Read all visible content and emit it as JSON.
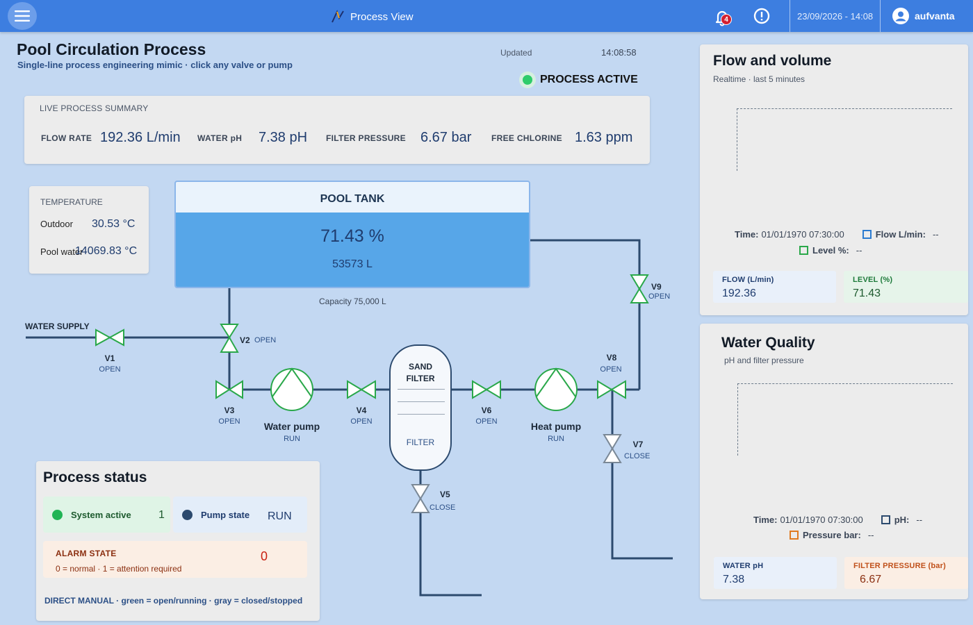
{
  "topbar": {
    "app_title": "Process View",
    "notification_count": "4",
    "datetime": "23/09/2026 - 14:08",
    "user": "aufvanta"
  },
  "header": {
    "title": "Pool Circulation Process",
    "subtitle": "Single-line process engineering mimic · click any valve or pump",
    "updated_label": "Updated",
    "updated_time": "14:08:58",
    "process_state": "PROCESS ACTIVE"
  },
  "summary": {
    "title": "LIVE PROCESS SUMMARY",
    "flow_label": "FLOW RATE",
    "flow_value": "192.36 L/min",
    "ph_label": "WATER pH",
    "ph_value": "7.38 pH",
    "pressure_label": "FILTER PRESSURE",
    "pressure_value": "6.67 bar",
    "chlorine_label": "FREE CHLORINE",
    "chlorine_value": "1.63 ppm"
  },
  "temperature": {
    "title": "TEMPERATURE",
    "outdoor_label": "Outdoor",
    "outdoor_value": "30.53 °C",
    "pool_label": "Pool water",
    "pool_value": "14069.83 °C"
  },
  "tank": {
    "title": "POOL TANK",
    "level": "71.43 %",
    "level_fraction": 0.7143,
    "volume": "53573 L",
    "capacity": "Capacity 75,000 L"
  },
  "pid": {
    "water_supply": "WATER SUPPLY",
    "sand_filter_line1": "SAND",
    "sand_filter_line2": "FILTER",
    "filter_text": "FILTER",
    "valves": {
      "v1": {
        "name": "V1",
        "state": "OPEN"
      },
      "v2": {
        "name": "V2",
        "state": "OPEN"
      },
      "v3": {
        "name": "V3",
        "state": "OPEN"
      },
      "v4": {
        "name": "V4",
        "state": "OPEN"
      },
      "v5": {
        "name": "V5",
        "state": "CLOSE"
      },
      "v6": {
        "name": "V6",
        "state": "OPEN"
      },
      "v7": {
        "name": "V7",
        "state": "CLOSE"
      },
      "v8": {
        "name": "V8",
        "state": "OPEN"
      },
      "v9": {
        "name": "V9",
        "state": "OPEN"
      }
    },
    "water_pump": {
      "name": "Water pump",
      "state": "RUN"
    },
    "heat_pump": {
      "name": "Heat pump",
      "state": "RUN"
    }
  },
  "status": {
    "title": "Process status",
    "system_active_label": "System active",
    "system_active_value": "1",
    "pump_state_label": "Pump state",
    "pump_state_value": "RUN",
    "alarm_label": "ALARM STATE",
    "alarm_desc": "0 = normal · 1 = attention required",
    "alarm_value": "0",
    "footer": "DIRECT MANUAL · green = open/running · gray = closed/stopped"
  },
  "flow_panel": {
    "title": "Flow and volume",
    "subtitle": "Realtime · last 5 minutes",
    "tooltip_time_label": "Time:",
    "tooltip_time": "01/01/1970 07:30:00",
    "legend_flow": "Flow L/min:",
    "legend_flow_value": "--",
    "legend_level": "Level %:",
    "legend_level_value": "--",
    "kpi_flow_label": "FLOW (L/min)",
    "kpi_flow_value": "192.36",
    "kpi_level_label": "LEVEL (%)",
    "kpi_level_value": "71.43"
  },
  "wq_panel": {
    "title": "Water Quality",
    "subtitle": "pH and filter pressure",
    "tooltip_time_label": "Time:",
    "tooltip_time": "01/01/1970 07:30:00",
    "legend_ph": "pH:",
    "legend_ph_value": "--",
    "legend_pressure": "Pressure bar:",
    "legend_pressure_value": "--",
    "kpi_ph_label": "WATER pH",
    "kpi_ph_value": "7.38",
    "kpi_pressure_label": "FILTER PRESSURE (bar)",
    "kpi_pressure_value": "6.67"
  },
  "colors": {
    "topbar": "#3d7ee0",
    "background": "#c3d8f2",
    "pipe": "#2c4a6e",
    "valve_open": "#2aa84a",
    "valve_closed": "#7a8896",
    "tank_water": "#57a6e8",
    "flow_series": "#2b7bd0",
    "level_series": "#2aa84a",
    "ph_series": "#2c4a6e",
    "pressure_series": "#e07a20",
    "alarm": "#c82010"
  }
}
